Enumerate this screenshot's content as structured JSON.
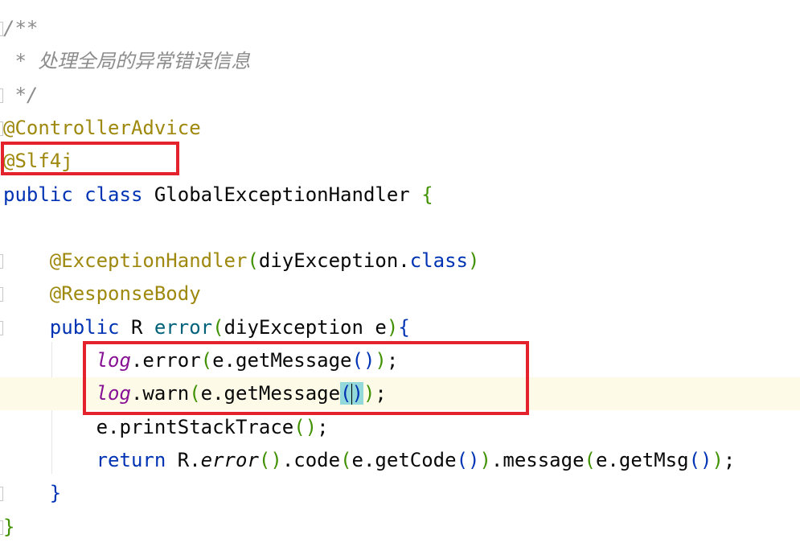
{
  "editor": {
    "lines": [
      {
        "tokens": [
          {
            "t": "/**",
            "c": "cm"
          }
        ]
      },
      {
        "tokens": [
          {
            "t": " * ",
            "c": "cm"
          },
          {
            "t": "处理全局的异常错误信息",
            "c": "cm-cn"
          }
        ]
      },
      {
        "tokens": [
          {
            "t": " */",
            "c": "cm"
          }
        ]
      },
      {
        "tokens": [
          {
            "t": "@ControllerAdvice",
            "c": "ann"
          }
        ]
      },
      {
        "tokens": [
          {
            "t": "@Slf4j",
            "c": "ann"
          }
        ]
      },
      {
        "tokens": [
          {
            "t": "public ",
            "c": "kw"
          },
          {
            "t": "class ",
            "c": "kw"
          },
          {
            "t": "GlobalExceptionHandler ",
            "c": "plain"
          },
          {
            "t": "{",
            "c": "p2"
          }
        ]
      },
      {
        "tokens": []
      },
      {
        "tokens": [
          {
            "t": "    ",
            "c": "plain"
          },
          {
            "t": "@ExceptionHandler",
            "c": "ann"
          },
          {
            "t": "(",
            "c": "p2"
          },
          {
            "t": "diyException.",
            "c": "plain"
          },
          {
            "t": "class",
            "c": "kw"
          },
          {
            "t": ")",
            "c": "p2"
          }
        ]
      },
      {
        "tokens": [
          {
            "t": "    ",
            "c": "plain"
          },
          {
            "t": "@ResponseBody",
            "c": "ann"
          }
        ]
      },
      {
        "tokens": [
          {
            "t": "    ",
            "c": "plain"
          },
          {
            "t": "public ",
            "c": "kw"
          },
          {
            "t": "R ",
            "c": "plain"
          },
          {
            "t": "error",
            "c": "fn"
          },
          {
            "t": "(",
            "c": "p2"
          },
          {
            "t": "diyException e",
            "c": "plain"
          },
          {
            "t": ")",
            "c": "p2"
          },
          {
            "t": "{",
            "c": "p1"
          }
        ]
      },
      {
        "tokens": [
          {
            "t": "        ",
            "c": "plain"
          },
          {
            "t": "log",
            "c": "fld"
          },
          {
            "t": ".error",
            "c": "plain"
          },
          {
            "t": "(",
            "c": "p2"
          },
          {
            "t": "e.getMessage",
            "c": "plain"
          },
          {
            "t": "()",
            "c": "p1"
          },
          {
            "t": ")",
            "c": "p2"
          },
          {
            "t": ";",
            "c": "plain"
          }
        ]
      },
      {
        "tokens": [
          {
            "t": "        ",
            "c": "plain"
          },
          {
            "t": "log",
            "c": "fld"
          },
          {
            "t": ".warn",
            "c": "plain"
          },
          {
            "t": "(",
            "c": "p2"
          },
          {
            "t": "e.getMessage",
            "c": "plain"
          },
          {
            "t": "(",
            "c": "p1 brace-match"
          },
          {
            "t": ")",
            "c": "p1 brace-match"
          },
          {
            "t": ")",
            "c": "p2"
          },
          {
            "t": ";",
            "c": "plain"
          }
        ],
        "current": true
      },
      {
        "tokens": [
          {
            "t": "        ",
            "c": "plain"
          },
          {
            "t": "e.printStackTrace",
            "c": "plain"
          },
          {
            "t": "()",
            "c": "p2"
          },
          {
            "t": ";",
            "c": "plain"
          }
        ]
      },
      {
        "tokens": [
          {
            "t": "        ",
            "c": "plain"
          },
          {
            "t": "return ",
            "c": "kw"
          },
          {
            "t": "R.",
            "c": "plain"
          },
          {
            "t": "error",
            "c": "stat"
          },
          {
            "t": "()",
            "c": "p2"
          },
          {
            "t": ".code",
            "c": "plain"
          },
          {
            "t": "(",
            "c": "p2"
          },
          {
            "t": "e.getCode",
            "c": "plain"
          },
          {
            "t": "()",
            "c": "p1"
          },
          {
            "t": ")",
            "c": "p2"
          },
          {
            "t": ".message",
            "c": "plain"
          },
          {
            "t": "(",
            "c": "p2"
          },
          {
            "t": "e.getMsg",
            "c": "plain"
          },
          {
            "t": "()",
            "c": "p1"
          },
          {
            "t": ")",
            "c": "p2"
          },
          {
            "t": ";",
            "c": "plain"
          }
        ]
      },
      {
        "tokens": [
          {
            "t": "    ",
            "c": "plain"
          },
          {
            "t": "}",
            "c": "p1"
          }
        ]
      },
      {
        "tokens": [
          {
            "t": "}",
            "c": "p2"
          }
        ]
      }
    ]
  },
  "highlight_color": "#e3222b"
}
